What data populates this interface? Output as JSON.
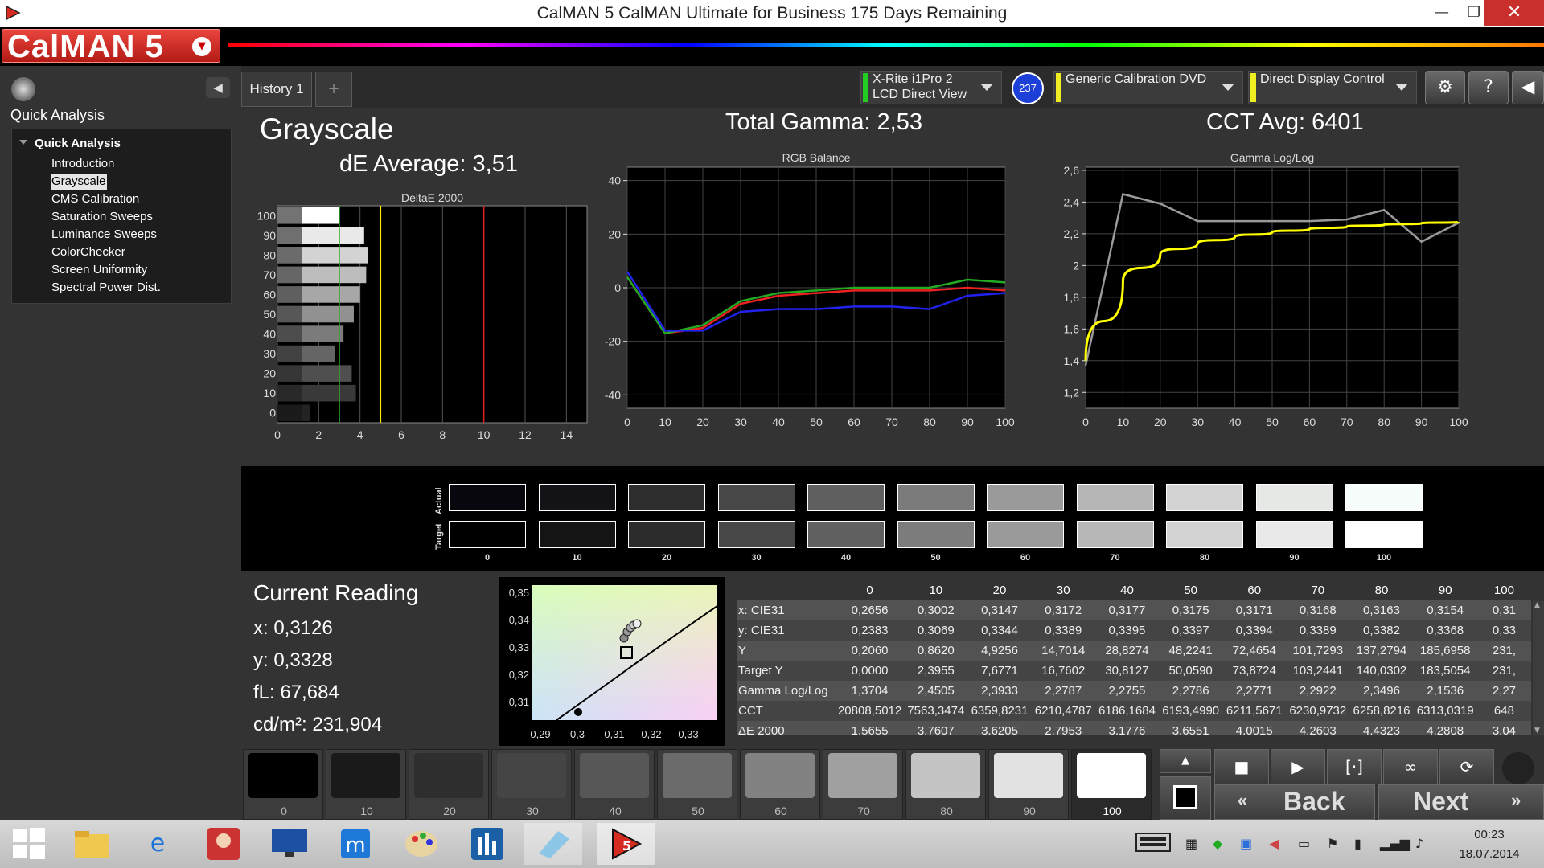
{
  "window": {
    "title": "CalMAN 5 CalMAN Ultimate for Business 175 Days Remaining",
    "minimize": "—",
    "restore": "❐",
    "close": "✕"
  },
  "brand": {
    "logo": "CalMAN 5"
  },
  "nav": {
    "heading": "Quick Analysis",
    "root": "Quick Analysis",
    "items": [
      "Introduction",
      "Grayscale",
      "CMS Calibration",
      "Saturation Sweeps",
      "Luminance Sweeps",
      "ColorChecker",
      "Screen Uniformity",
      "Spectral Power Dist."
    ],
    "selected": "Grayscale"
  },
  "tabs": {
    "history": "History 1",
    "add": "+"
  },
  "devices": {
    "meter_line1": "X-Rite i1Pro 2",
    "meter_line2": "LCD Direct View",
    "meter_badge": "237",
    "source": "Generic Calibration DVD",
    "display": "Direct Display Control"
  },
  "toolbar_icons": {
    "settings": "⚙",
    "help": "?",
    "collapse": "◀"
  },
  "summary": {
    "title": "Grayscale",
    "de_avg": "dE Average: 3,51",
    "gamma": "Total Gamma: 2,53",
    "cct": "CCT Avg: 6401"
  },
  "chart_data": [
    {
      "type": "bar",
      "title": "DeltaE 2000",
      "orientation": "horizontal",
      "categories": [
        "100",
        "90",
        "80",
        "70",
        "60",
        "50",
        "40",
        "30",
        "20",
        "10",
        "0"
      ],
      "values": [
        3.0,
        4.2,
        4.4,
        4.3,
        4.0,
        3.7,
        3.2,
        2.8,
        3.6,
        3.8,
        1.6
      ],
      "xlim": [
        0,
        15
      ],
      "xticks": [
        "0",
        "2",
        "4",
        "6",
        "8",
        "10",
        "12",
        "14"
      ],
      "yticks": [
        "100",
        "90",
        "80",
        "70",
        "60",
        "50",
        "40",
        "30",
        "20",
        "10",
        "0"
      ],
      "thresholds": [
        {
          "value": 3,
          "color": "#33aa33"
        },
        {
          "value": 5,
          "color": "#ffee00"
        },
        {
          "value": 10,
          "color": "#dd2222"
        }
      ]
    },
    {
      "type": "line",
      "title": "RGB Balance",
      "x": [
        0,
        10,
        20,
        30,
        40,
        50,
        60,
        70,
        80,
        90,
        100
      ],
      "series": [
        {
          "color": "#ee2222",
          "values": [
            4,
            -17,
            -15,
            -6,
            -3,
            -2,
            -1,
            -1,
            -1,
            0,
            -1
          ]
        },
        {
          "color": "#22aa22",
          "values": [
            4,
            -17,
            -14,
            -5,
            -2,
            -1,
            0,
            0,
            0,
            3,
            2
          ]
        },
        {
          "color": "#2222ee",
          "values": [
            6,
            -16,
            -16,
            -9,
            -8,
            -8,
            -7,
            -7,
            -8,
            -3,
            -2
          ]
        }
      ],
      "xlim": [
        0,
        100
      ],
      "ylim": [
        -45,
        45
      ],
      "xticks": [
        "0",
        "10",
        "20",
        "30",
        "40",
        "50",
        "60",
        "70",
        "80",
        "90",
        "100"
      ],
      "yticks": [
        "40",
        "20",
        "0",
        "-20",
        "-40"
      ]
    },
    {
      "type": "line",
      "title": "Gamma Log/Log",
      "x": [
        0,
        10,
        20,
        30,
        40,
        50,
        60,
        70,
        80,
        90,
        100
      ],
      "series": [
        {
          "color": "#9a9a9a",
          "values": [
            1.37,
            2.45,
            2.39,
            2.28,
            2.28,
            2.28,
            2.28,
            2.29,
            2.35,
            2.15,
            2.27
          ]
        },
        {
          "color": "#ffff00",
          "values": [
            1.4,
            1.9,
            2.07,
            2.14,
            2.18,
            2.21,
            2.23,
            2.245,
            2.257,
            2.266,
            2.275
          ],
          "curve": true
        }
      ],
      "xlim": [
        0,
        100
      ],
      "ylim": [
        1.1,
        2.62
      ],
      "xticks": [
        "0",
        "10",
        "20",
        "30",
        "40",
        "50",
        "60",
        "70",
        "80",
        "90",
        "100"
      ],
      "yticks": [
        "2,6",
        "2,4",
        "2,2",
        "2",
        "1,8",
        "1,6",
        "1,4",
        "1,2"
      ]
    }
  ],
  "swatches": {
    "actual_label": "Actual",
    "target_label": "Target",
    "labels": [
      "0",
      "10",
      "20",
      "30",
      "40",
      "50",
      "60",
      "70",
      "80",
      "90",
      "100"
    ],
    "actual": [
      "#07070d",
      "#131317",
      "#2d2d2d",
      "#474747",
      "#5f5f5f",
      "#7b7b7b",
      "#9a9a9a",
      "#b5b5b5",
      "#d2d2d2",
      "#e6e8e6",
      "#f6fdfb"
    ],
    "target": [
      "#000000",
      "#141414",
      "#2c2c2c",
      "#474747",
      "#616161",
      "#7c7c7c",
      "#9a9a9a",
      "#b7b7b7",
      "#d2d2d2",
      "#e9e9e9",
      "#ffffff"
    ]
  },
  "reading": {
    "title": "Current Reading",
    "x": "x: 0,3126",
    "y": "y: 0,3328",
    "fl": "fL: 67,684",
    "cd": "cd/m²: 231,904"
  },
  "cie_plot": {
    "xticks": [
      "0,29",
      "0,3",
      "0,31",
      "0,32",
      "0,33"
    ],
    "yticks": [
      "0,35",
      "0,34",
      "0,33",
      "0,32",
      "0,31"
    ]
  },
  "table": {
    "columns": [
      "0",
      "10",
      "20",
      "30",
      "40",
      "50",
      "60",
      "70",
      "80",
      "90",
      "100"
    ],
    "rows": [
      {
        "label": "x: CIE31",
        "values": [
          "0,2656",
          "0,3002",
          "0,3147",
          "0,3172",
          "0,3177",
          "0,3175",
          "0,3171",
          "0,3168",
          "0,3163",
          "0,3154",
          "0,31"
        ]
      },
      {
        "label": "y: CIE31",
        "values": [
          "0,2383",
          "0,3069",
          "0,3344",
          "0,3389",
          "0,3395",
          "0,3397",
          "0,3394",
          "0,3389",
          "0,3382",
          "0,3368",
          "0,33"
        ]
      },
      {
        "label": "Y",
        "values": [
          "0,2060",
          "0,8620",
          "4,9256",
          "14,7014",
          "28,8274",
          "48,2241",
          "72,4654",
          "101,7293",
          "137,2794",
          "185,6958",
          "231,"
        ]
      },
      {
        "label": "Target Y",
        "values": [
          "0,0000",
          "2,3955",
          "7,6771",
          "16,7602",
          "30,8127",
          "50,0590",
          "73,8724",
          "103,2441",
          "140,0302",
          "183,5054",
          "231,"
        ]
      },
      {
        "label": "Gamma Log/Log",
        "values": [
          "1,3704",
          "2,4505",
          "2,3933",
          "2,2787",
          "2,2755",
          "2,2786",
          "2,2771",
          "2,2922",
          "2,3496",
          "2,1536",
          "2,27"
        ]
      },
      {
        "label": "CCT",
        "values": [
          "20808,5012",
          "7563,3474",
          "6359,8231",
          "6210,4787",
          "6186,1684",
          "6193,4990",
          "6211,5671",
          "6230,9732",
          "6258,8216",
          "6313,0319",
          "648"
        ]
      },
      {
        "label": "ΔE 2000",
        "values": [
          "1,5655",
          "3,7607",
          "3,6205",
          "2,7953",
          "3,1776",
          "3,6551",
          "4,0015",
          "4,2603",
          "4,4323",
          "4,2808",
          "3,04"
        ]
      }
    ]
  },
  "patches": {
    "labels": [
      "0",
      "10",
      "20",
      "30",
      "40",
      "50",
      "60",
      "70",
      "80",
      "90",
      "100"
    ],
    "colors": [
      "#000000",
      "#1a1a1a",
      "#2e2e2e",
      "#454545",
      "#575757",
      "#6b6b6b",
      "#828282",
      "#a0a0a0",
      "#c4c4c4",
      "#e2e2e2",
      "#ffffff"
    ],
    "selected": "100"
  },
  "buttons": {
    "back": "Back",
    "next": "Next"
  },
  "clock": {
    "time": "00:23",
    "date": "18.07.2014"
  }
}
